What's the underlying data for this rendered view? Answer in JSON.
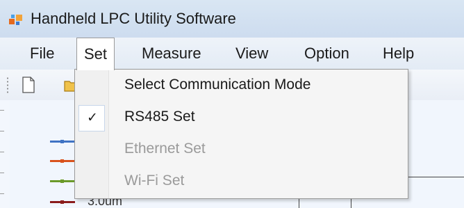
{
  "window": {
    "title": "Handheld LPC Utility Software"
  },
  "menubar": {
    "items": [
      {
        "label": "File"
      },
      {
        "label": "Set"
      },
      {
        "label": "Measure"
      },
      {
        "label": "View"
      },
      {
        "label": "Option"
      },
      {
        "label": "Help"
      }
    ],
    "active_item": "Set"
  },
  "toolbar": {
    "icons": [
      "new-document-icon",
      "open-folder-icon"
    ]
  },
  "set_menu": {
    "items": [
      {
        "label": "Select Communication Mode",
        "enabled": true,
        "checked": false
      },
      {
        "label": "RS485 Set",
        "enabled": true,
        "checked": true
      },
      {
        "label": "Ethernet Set",
        "enabled": false,
        "checked": false
      },
      {
        "label": "Wi-Fi Set",
        "enabled": false,
        "checked": false
      }
    ],
    "check_glyph": "✓"
  },
  "chart_legend": {
    "series_colors": [
      "#3f73c4",
      "#d9531e",
      "#6b9a2a",
      "#8b1c1c"
    ],
    "partial_label": "3.0um"
  },
  "colors": {
    "titlebar": "#cddcef",
    "menubar": "#e3ebf5",
    "dropdown_bg": "#f5f5f5",
    "disabled_text": "#9a9a9a"
  }
}
